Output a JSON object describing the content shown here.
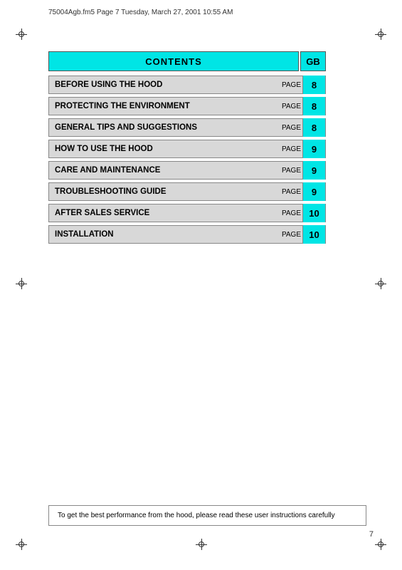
{
  "file_info": {
    "text": "75004Agb.fm5  Page 7  Tuesday, March 27, 2001  10:55 AM"
  },
  "contents_header": {
    "title": "CONTENTS",
    "gb_label": "GB"
  },
  "toc_items": [
    {
      "label": "BEFORE USING THE HOOD",
      "page_word": "PAGE",
      "page_num": "8"
    },
    {
      "label": "PROTECTING THE ENVIRONMENT",
      "page_word": "PAGE",
      "page_num": "8"
    },
    {
      "label": "GENERAL TIPS AND SUGGESTIONS",
      "page_word": "PAGE",
      "page_num": "8"
    },
    {
      "label": "HOW TO USE THE HOOD",
      "page_word": "PAGE",
      "page_num": "9"
    },
    {
      "label": "CARE AND MAINTENANCE",
      "page_word": "PAGE",
      "page_num": "9"
    },
    {
      "label": "TROUBLESHOOTING GUIDE",
      "page_word": "PAGE",
      "page_num": "9"
    },
    {
      "label": "AFTER SALES SERVICE",
      "page_word": "PAGE",
      "page_num": "10"
    },
    {
      "label": "INSTALLATION",
      "page_word": "PAGE",
      "page_num": "10"
    }
  ],
  "bottom_note": "To get the best performance from the hood, please read these user instructions carefully",
  "page_number": "7"
}
